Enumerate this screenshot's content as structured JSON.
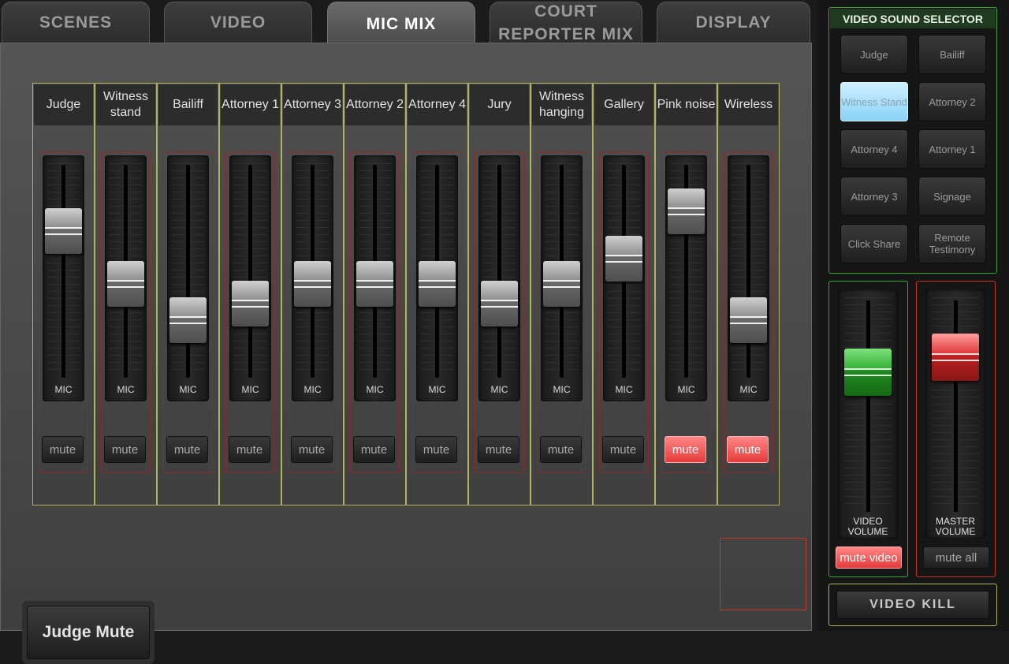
{
  "tabs": [
    {
      "label": "SCENES",
      "active": false
    },
    {
      "label": "VIDEO",
      "active": false
    },
    {
      "label": "MIC MIX",
      "active": true
    },
    {
      "label": "COURT REPORTER MIX",
      "active": false
    },
    {
      "label": "DISPLAY",
      "active": false
    }
  ],
  "channels": [
    {
      "label": "Judge",
      "fader_tag": "MIC",
      "level": 0.69,
      "mute_label": "mute",
      "muted": false
    },
    {
      "label": "Witness stand",
      "fader_tag": "MIC",
      "level": 0.44,
      "mute_label": "mute",
      "muted": false
    },
    {
      "label": "Bailiff",
      "fader_tag": "MIC",
      "level": 0.27,
      "mute_label": "mute",
      "muted": false
    },
    {
      "label": "Attorney 1",
      "fader_tag": "MIC",
      "level": 0.35,
      "mute_label": "mute",
      "muted": false
    },
    {
      "label": "Attorney 3",
      "fader_tag": "MIC",
      "level": 0.44,
      "mute_label": "mute",
      "muted": false
    },
    {
      "label": "Attorney 2",
      "fader_tag": "MIC",
      "level": 0.44,
      "mute_label": "mute",
      "muted": false
    },
    {
      "label": "Attorney 4",
      "fader_tag": "MIC",
      "level": 0.44,
      "mute_label": "mute",
      "muted": false
    },
    {
      "label": "Jury",
      "fader_tag": "MIC",
      "level": 0.35,
      "mute_label": "mute",
      "muted": false
    },
    {
      "label": "Witness hanging",
      "fader_tag": "MIC",
      "level": 0.44,
      "mute_label": "mute",
      "muted": false
    },
    {
      "label": "Gallery",
      "fader_tag": "MIC",
      "level": 0.56,
      "mute_label": "mute",
      "muted": false
    },
    {
      "label": "Pink noise",
      "fader_tag": "MIC",
      "level": 0.78,
      "mute_label": "mute",
      "muted": true
    },
    {
      "label": "Wireless",
      "fader_tag": "MIC",
      "level": 0.27,
      "mute_label": "mute",
      "muted": true
    }
  ],
  "judge_mute_label": "Judge Mute",
  "video_sound_selector": {
    "title": "VIDEO SOUND SELECTOR",
    "buttons": [
      {
        "label": "Judge",
        "selected": false
      },
      {
        "label": "Bailiff",
        "selected": false
      },
      {
        "label": "Witness Stand",
        "selected": true
      },
      {
        "label": "Attorney 2",
        "selected": false
      },
      {
        "label": "Attorney 4",
        "selected": false
      },
      {
        "label": "Attorney 1",
        "selected": false
      },
      {
        "label": "Attorney 3",
        "selected": false
      },
      {
        "label": "Signage",
        "selected": false
      },
      {
        "label": "Click Share",
        "selected": false
      },
      {
        "label": "Remote Testimony",
        "selected": false
      }
    ]
  },
  "video_volume": {
    "label": "VIDEO VOLUME",
    "level": 0.66,
    "mute_label": "mute video",
    "muted": true,
    "color": "#2fb02f"
  },
  "master_volume": {
    "label": "MASTER VOLUME",
    "level": 0.73,
    "mute_label": "mute all",
    "muted": false,
    "color": "#d33333"
  },
  "video_kill_label": "VIDEO KILL"
}
